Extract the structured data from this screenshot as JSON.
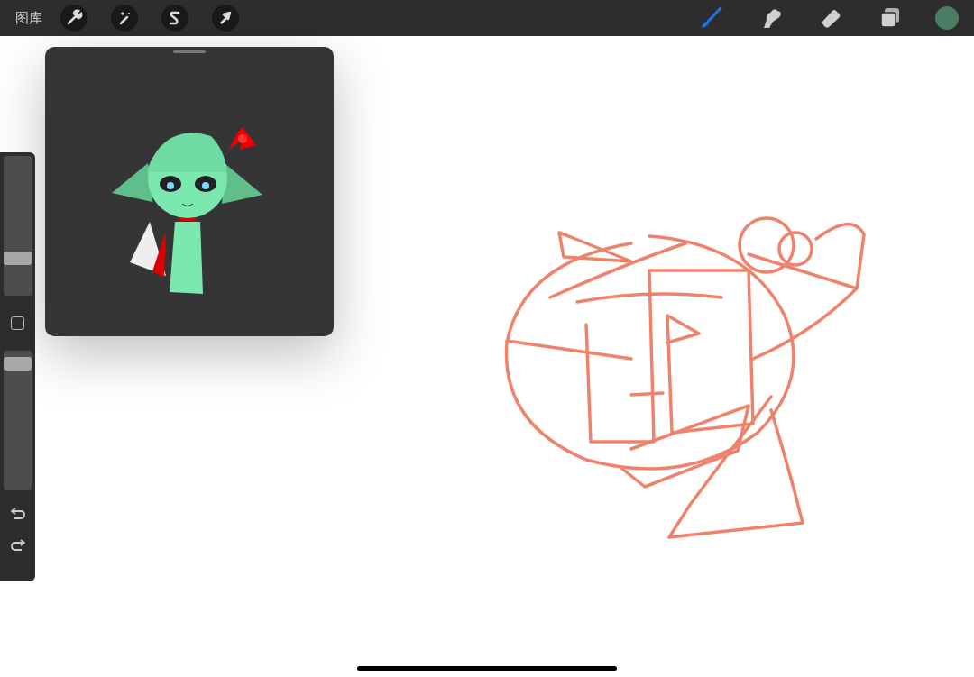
{
  "toolbar": {
    "gallery": "图库",
    "actions": [
      {
        "kind": "wrench"
      },
      {
        "kind": "wand"
      },
      {
        "kind": "selection"
      },
      {
        "kind": "transform"
      }
    ],
    "tools": [
      {
        "kind": "brush",
        "selected": true
      },
      {
        "kind": "smudge",
        "selected": false
      },
      {
        "kind": "eraser",
        "selected": false
      },
      {
        "kind": "layers",
        "selected": false
      }
    ],
    "color": "#4a7d63"
  },
  "sidebar": {
    "size_slider": {
      "level": 0.24
    },
    "opacity_slider": {
      "level": 0.95
    }
  }
}
